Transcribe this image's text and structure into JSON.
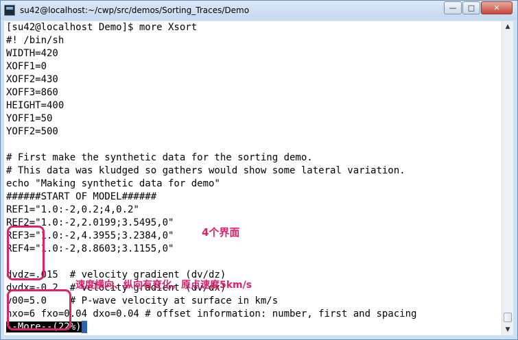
{
  "window": {
    "title": "su42@localhost:~/cwp/src/demos/Sorting_Traces/Demo",
    "buttons": {
      "minimize": "—",
      "maximize": "□",
      "close": "✕"
    }
  },
  "terminal": {
    "lines": [
      "[su42@localhost Demo]$ more Xsort",
      "#! /bin/sh",
      "WIDTH=420",
      "XOFF1=0",
      "XOFF2=430",
      "XOFF3=860",
      "HEIGHT=400",
      "YOFF1=50",
      "YOFF2=500",
      "",
      "# First make the synthetic data for the sorting demo.",
      "# This data was kludged so gathers would show some lateral variation.",
      "echo \"Making synthetic data for demo\"",
      "######START OF MODEL######",
      "REF1=\"1.0:-2,0.2;4,0.2\"",
      "REF2=\"1.0:-2,2.0199;3.5495,0\"",
      "REF3=\"1.0:-2,4.3955;3.2384,0\"",
      "REF4=\"1.0:-2,8.8603;3.1155,0\"",
      "",
      "dvdz=.015  # velocity gradient (dv/dz)",
      "dvdx=-0.2  # velocity gradient (dv/dx)",
      "v00=5.0    # P-wave velocity at surface in km/s",
      "nxo=6 fxo=0.04 dxo=0.04 # offset information: number, first and spacing"
    ],
    "pager_prompt": "--More--(22%)"
  },
  "annotations": {
    "interfaces": "4个界面",
    "velocity_note": "速度横向、纵向有变化，原点速度5km/s"
  },
  "colors": {
    "annotation": "#e0206a",
    "cursor": "#2f63b8",
    "title_bar": "#c5d9ee"
  }
}
